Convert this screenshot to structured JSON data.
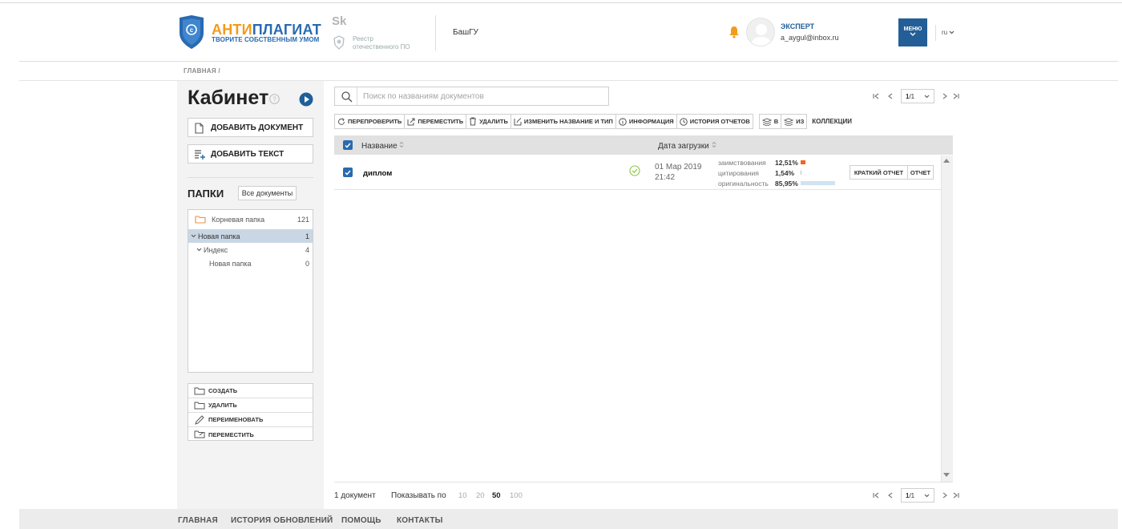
{
  "header": {
    "logo_part1": "АНТИ",
    "logo_part2": "ПЛАГИАТ",
    "logo_tagline": "ТВОРИТЕ СОБСТВЕННЫМ УМОМ",
    "sk_mark": "Sk",
    "registry_line1": "Реестр",
    "registry_line2": "отечественного ПО",
    "organization": "БашГУ",
    "user_role": "ЭКСПЕРТ",
    "user_email": "a_aygul@inbox.ru",
    "menu_label": "МЕНЮ",
    "language": "ru"
  },
  "breadcrumb": "ГЛАВНАЯ /",
  "sidebar": {
    "title": "Кабинет",
    "add_document": "ДОБАВИТЬ ДОКУМЕНТ",
    "add_text": "ДОБАВИТЬ ТЕКСТ",
    "folders_title": "ПАПКИ",
    "all_documents": "Все документы",
    "tree": [
      {
        "label": "Корневая папка",
        "count": "121"
      },
      {
        "label": "Новая папка",
        "count": "1"
      },
      {
        "label": "Индекс",
        "count": "4"
      },
      {
        "label": "Новая папка",
        "count": "0"
      }
    ],
    "actions": [
      "СОЗДАТЬ",
      "УДАЛИТЬ",
      "ПЕРЕИМЕНОВАТЬ",
      "ПЕРЕМЕСТИТЬ"
    ]
  },
  "search": {
    "placeholder": "Поиск по названиям документов"
  },
  "pager": {
    "current": "1",
    "total": "/1"
  },
  "toolbar": {
    "recheck": "ПЕРЕПРОВЕРИТЬ",
    "move": "ПЕРЕМЕСТИТЬ",
    "delete": "УДАЛИТЬ",
    "rename": "ИЗМЕНИТЬ НАЗВАНИЕ И ТИП",
    "info": "ИНФОРМАЦИЯ",
    "history": "ИСТОРИЯ ОТЧЕТОВ",
    "to": "В",
    "from": "ИЗ",
    "collections": "КОЛЛЕКЦИИ"
  },
  "table": {
    "col_name": "Название",
    "col_date": "Дата загрузки",
    "rows": [
      {
        "name": "диплом",
        "date": "01 Мар 2019",
        "time": "21:42",
        "borrowing_label": "заимствования",
        "borrowing_value": "12,51%",
        "borrowing_pct": 12.51,
        "citation_label": "цитирования",
        "citation_value": "1,54%",
        "citation_pct": 1.54,
        "originality_label": "оригинальность",
        "originality_value": "85,95%",
        "originality_pct": 85.95,
        "short_report": "КРАТКИЙ ОТЧЕТ",
        "report": "ОТЧЕТ"
      }
    ]
  },
  "list_footer": {
    "count": "1 документ",
    "show_label": "Показывать по",
    "sizes": [
      "10",
      "20",
      "50",
      "100"
    ],
    "active_size": "50"
  },
  "footer": {
    "links": [
      "ГЛАВНАЯ",
      "ИСТОРИЯ ОБНОВЛЕНИЙ",
      "ПОМОЩЬ",
      "КОНТАКТЫ"
    ]
  },
  "colors": {
    "brand_blue": "#2a6ab0",
    "brand_orange": "#f29b1d",
    "menu_bg": "#245e97",
    "borrowing_bar": "#f26522",
    "originality_bar": "#cfe3f2"
  }
}
